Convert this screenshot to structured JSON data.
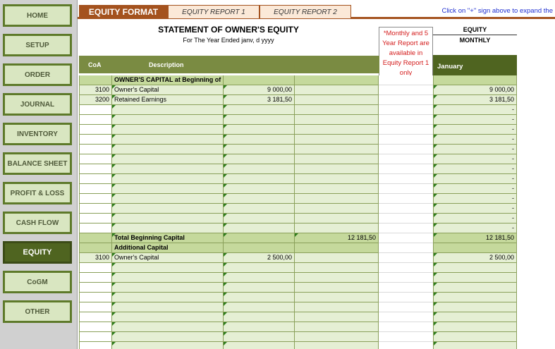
{
  "nav": {
    "home": "HOME",
    "setup": "SETUP",
    "order": "ORDER",
    "journal": "JOURNAL",
    "inventory": "INVENTORY",
    "balance_sheet": "BALANCE SHEET",
    "profit_loss": "PROFIT & LOSS",
    "cash_flow": "CASH FLOW",
    "equity": "EQUITY",
    "cogm": "CoGM",
    "other": "OTHER",
    "active": "EQUITY"
  },
  "tabs": {
    "format": "EQUITY FORMAT",
    "report1": "EQUITY REPORT 1",
    "report2": "EQUITY REPORT 2"
  },
  "expand_hint": "Click on \"+\" sign above to expand the",
  "statement": {
    "title": "STATEMENT OF OWNER'S EQUITY",
    "subtitle": "For The Year Ended janv, d yyyy"
  },
  "note": "*Monthly and 5 Year Report are available in Equity Report 1 only",
  "report_type": {
    "equity": "EQUITY",
    "monthly": "MONTHLY"
  },
  "columns": {
    "coa": "CoA",
    "description": "Description",
    "month": "January"
  },
  "rows": [
    {
      "type": "section",
      "coa": "",
      "desc": "OWNER'S CAPITAL at Beginning of Fiscal Year",
      "amount": "",
      "total": "",
      "month": ""
    },
    {
      "type": "data",
      "coa": "3100",
      "desc": "Owner's Capital",
      "amount": "9 000,00",
      "total": "",
      "month": "9 000,00"
    },
    {
      "type": "data",
      "coa": "3200",
      "desc": "Retained Earnings",
      "amount": "3 181,50",
      "total": "",
      "month": "3 181,50"
    },
    {
      "type": "blank",
      "coa": "",
      "desc": "",
      "amount": "",
      "total": "",
      "month": "-"
    },
    {
      "type": "blank",
      "coa": "",
      "desc": "",
      "amount": "",
      "total": "",
      "month": "-"
    },
    {
      "type": "blank",
      "coa": "",
      "desc": "",
      "amount": "",
      "total": "",
      "month": "-"
    },
    {
      "type": "blank",
      "coa": "",
      "desc": "",
      "amount": "",
      "total": "",
      "month": "-"
    },
    {
      "type": "blank",
      "coa": "",
      "desc": "",
      "amount": "",
      "total": "",
      "month": "-"
    },
    {
      "type": "blank",
      "coa": "",
      "desc": "",
      "amount": "",
      "total": "",
      "month": "-"
    },
    {
      "type": "blank",
      "coa": "",
      "desc": "",
      "amount": "",
      "total": "",
      "month": "-"
    },
    {
      "type": "blank",
      "coa": "",
      "desc": "",
      "amount": "",
      "total": "",
      "month": "-"
    },
    {
      "type": "blank",
      "coa": "",
      "desc": "",
      "amount": "",
      "total": "",
      "month": "-"
    },
    {
      "type": "blank",
      "coa": "",
      "desc": "",
      "amount": "",
      "total": "",
      "month": "-"
    },
    {
      "type": "blank",
      "coa": "",
      "desc": "",
      "amount": "",
      "total": "",
      "month": "-"
    },
    {
      "type": "blank",
      "coa": "",
      "desc": "",
      "amount": "",
      "total": "",
      "month": "-"
    },
    {
      "type": "blank",
      "coa": "",
      "desc": "",
      "amount": "",
      "total": "",
      "month": "-"
    },
    {
      "type": "total",
      "coa": "",
      "desc": "Total Beginning Capital",
      "amount": "",
      "total": "12 181,50",
      "month": "12 181,50"
    },
    {
      "type": "section",
      "coa": "",
      "desc": "Additional Capital",
      "amount": "",
      "total": "",
      "month": ""
    },
    {
      "type": "data",
      "coa": "3100",
      "desc": "Owner's Capital",
      "amount": "2 500,00",
      "total": "",
      "month": "2 500,00"
    },
    {
      "type": "blank",
      "coa": "",
      "desc": "",
      "amount": "",
      "total": "",
      "month": ""
    },
    {
      "type": "blank",
      "coa": "",
      "desc": "",
      "amount": "",
      "total": "",
      "month": ""
    },
    {
      "type": "blank",
      "coa": "",
      "desc": "",
      "amount": "",
      "total": "",
      "month": ""
    },
    {
      "type": "blank",
      "coa": "",
      "desc": "",
      "amount": "",
      "total": "",
      "month": ""
    },
    {
      "type": "blank",
      "coa": "",
      "desc": "",
      "amount": "",
      "total": "",
      "month": ""
    },
    {
      "type": "blank",
      "coa": "",
      "desc": "",
      "amount": "",
      "total": "",
      "month": ""
    },
    {
      "type": "blank",
      "coa": "",
      "desc": "",
      "amount": "",
      "total": "",
      "month": ""
    },
    {
      "type": "blank",
      "coa": "",
      "desc": "",
      "amount": "",
      "total": "",
      "month": ""
    },
    {
      "type": "blank",
      "coa": "",
      "desc": "",
      "amount": "",
      "total": "",
      "month": ""
    }
  ]
}
